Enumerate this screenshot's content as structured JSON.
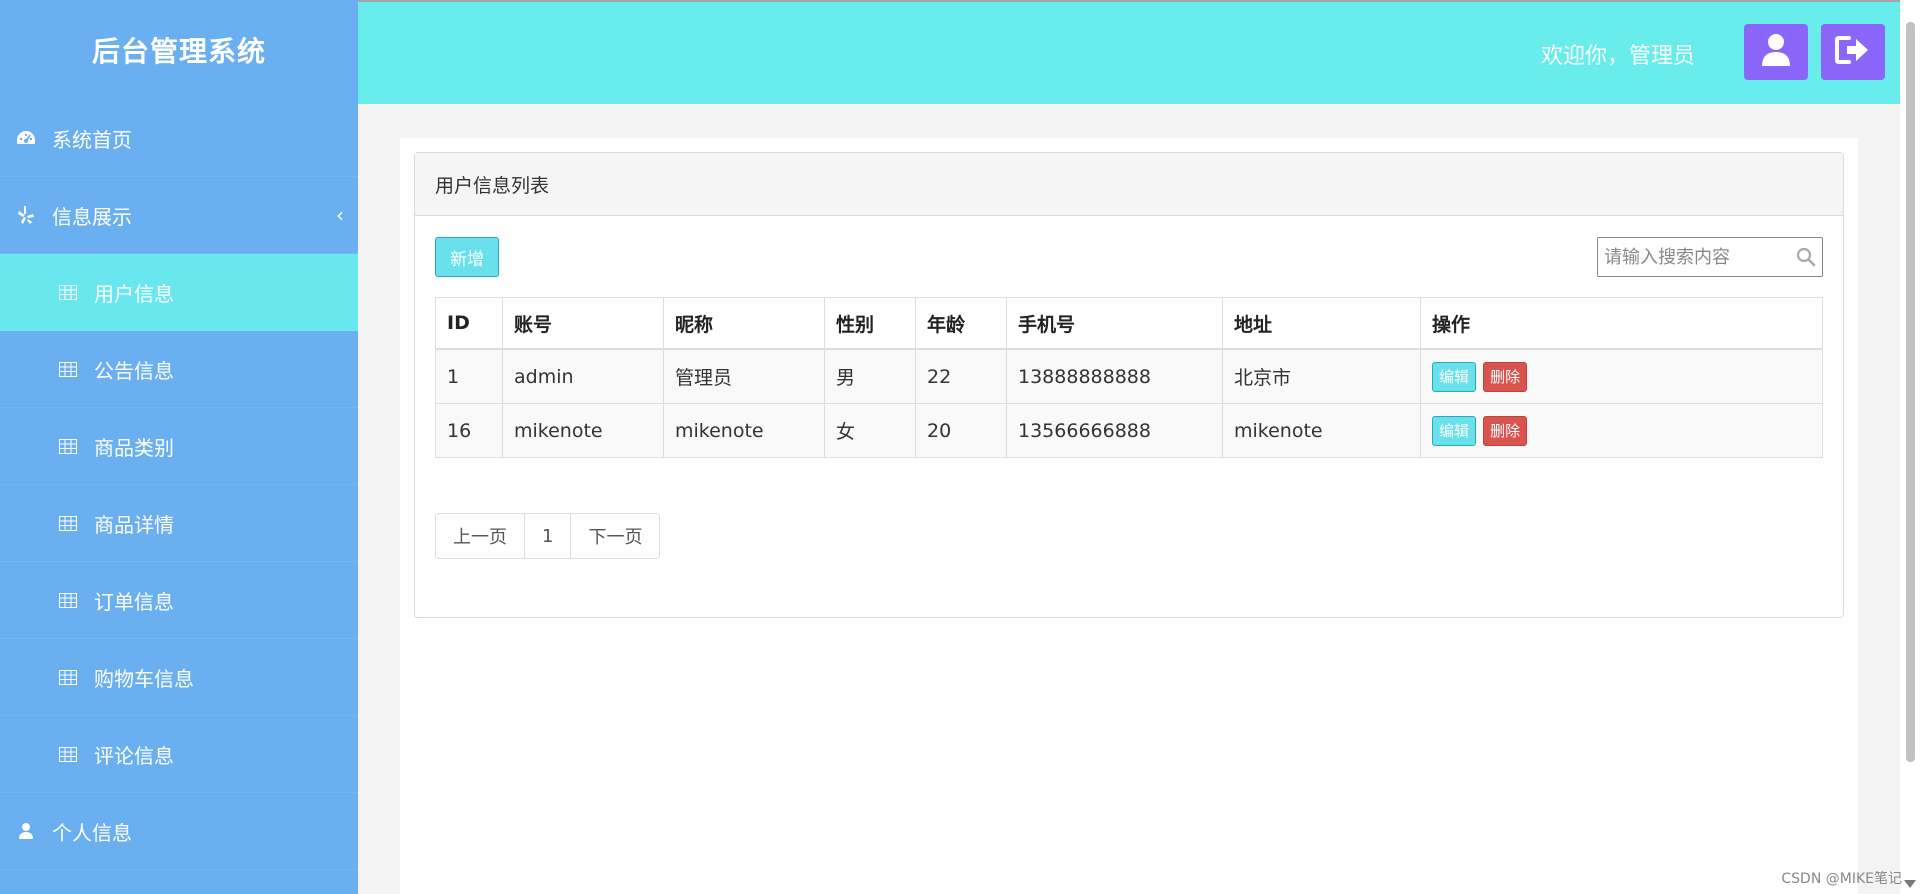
{
  "sidebar": {
    "brand": "后台管理系统",
    "items": [
      {
        "label": "系统首页",
        "icon": "dashboard-icon"
      },
      {
        "label": "信息展示",
        "icon": "yelp-icon",
        "chevron": "‹"
      },
      {
        "label": "用户信息",
        "icon": "table-icon"
      },
      {
        "label": "公告信息",
        "icon": "table-icon"
      },
      {
        "label": "商品类别",
        "icon": "table-icon"
      },
      {
        "label": "商品详情",
        "icon": "table-icon"
      },
      {
        "label": "订单信息",
        "icon": "table-icon"
      },
      {
        "label": "购物车信息",
        "icon": "table-icon"
      },
      {
        "label": "评论信息",
        "icon": "table-icon"
      },
      {
        "label": "个人信息",
        "icon": "user-icon"
      }
    ]
  },
  "header": {
    "welcome": "欢迎你，管理员",
    "user_icon": "user-icon",
    "logout_icon": "sign-out-icon",
    "bg_color": "#68ecec",
    "button_color": "#8a66fb"
  },
  "panel": {
    "title": "用户信息列表",
    "add_label": "新增",
    "search_placeholder": "请输入搜索内容"
  },
  "table": {
    "headers": [
      "ID",
      "账号",
      "昵称",
      "性别",
      "年龄",
      "手机号",
      "地址",
      "操作"
    ],
    "rows": [
      [
        "1",
        "admin",
        "管理员",
        "男",
        "22",
        "13888888888",
        "北京市"
      ],
      [
        "16",
        "mikenote",
        "mikenote",
        "女",
        "20",
        "13566666888",
        "mikenote"
      ]
    ],
    "edit_label": "编辑",
    "delete_label": "删除"
  },
  "pager": {
    "prev": "上一页",
    "current": "1",
    "next": "下一页"
  },
  "watermark": "CSDN @MIKE笔记",
  "colors": {
    "sidebar": "#6aaff0",
    "active_item": "#68e8ee",
    "delete": "#d9534f"
  }
}
